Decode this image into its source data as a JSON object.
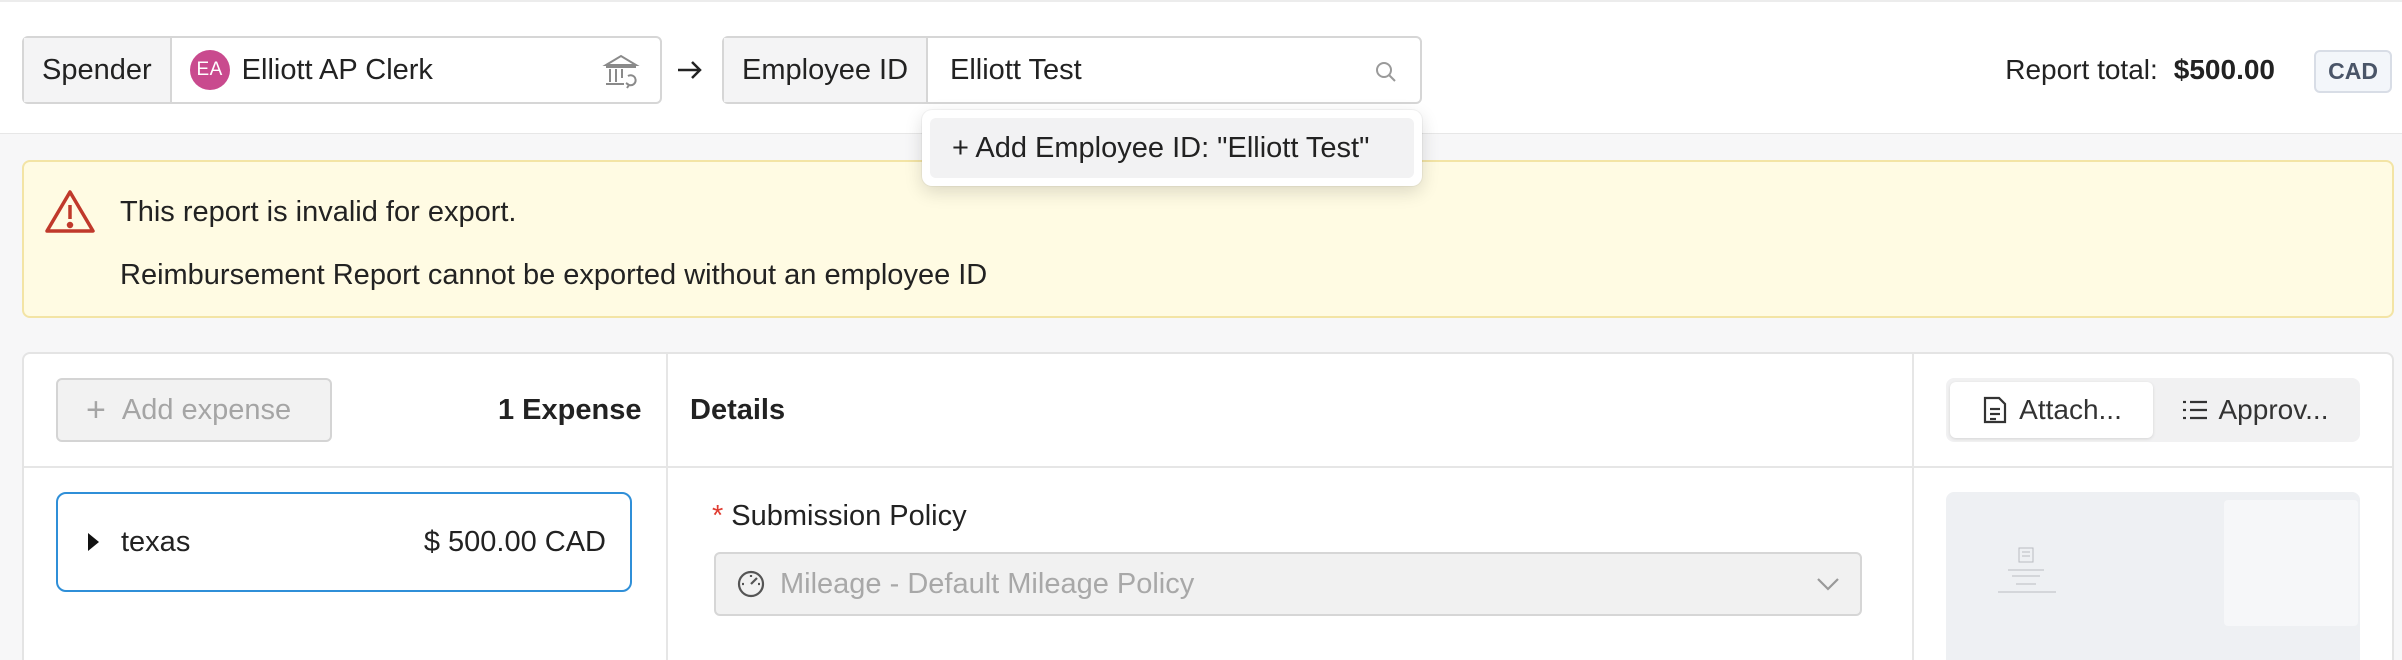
{
  "header": {
    "spender_label": "Spender",
    "spender_initials": "EA",
    "spender_name": "Elliott AP Clerk",
    "employee_id_label": "Employee ID",
    "employee_id_value": "Elliott Test",
    "report_total_label": "Report total:",
    "report_total_amount": "$500.00",
    "currency": "CAD"
  },
  "dropdown": {
    "option": "+ Add Employee ID: \"Elliott Test\""
  },
  "alert": {
    "title": "This report is invalid for export.",
    "message": "Reimbursement Report cannot be exported without an employee ID"
  },
  "expenses": {
    "add_label": "Add expense",
    "count_label": "1 Expense",
    "items": [
      {
        "name": "texas",
        "amount": "$ 500.00 CAD"
      }
    ]
  },
  "details": {
    "title": "Details",
    "policy_label": "Submission Policy",
    "policy_required_mark": "*",
    "policy_value": "Mileage - Default Mileage Policy"
  },
  "side_tabs": {
    "attachments_label": "Attach...",
    "approvals_label": "Approv..."
  },
  "colors": {
    "accent_blue": "#2f8fd8",
    "avatar": "#c94a8e",
    "alert_bg": "#fffbe3",
    "alert_icon": "#c0392b",
    "required": "#e03c31"
  },
  "icons": [
    "bank-transfer-icon",
    "arrow-right-icon",
    "search-icon",
    "warning-icon",
    "plus-icon",
    "document-icon",
    "list-icon",
    "caret-right-icon",
    "gauge-icon",
    "chevron-down-icon"
  ]
}
